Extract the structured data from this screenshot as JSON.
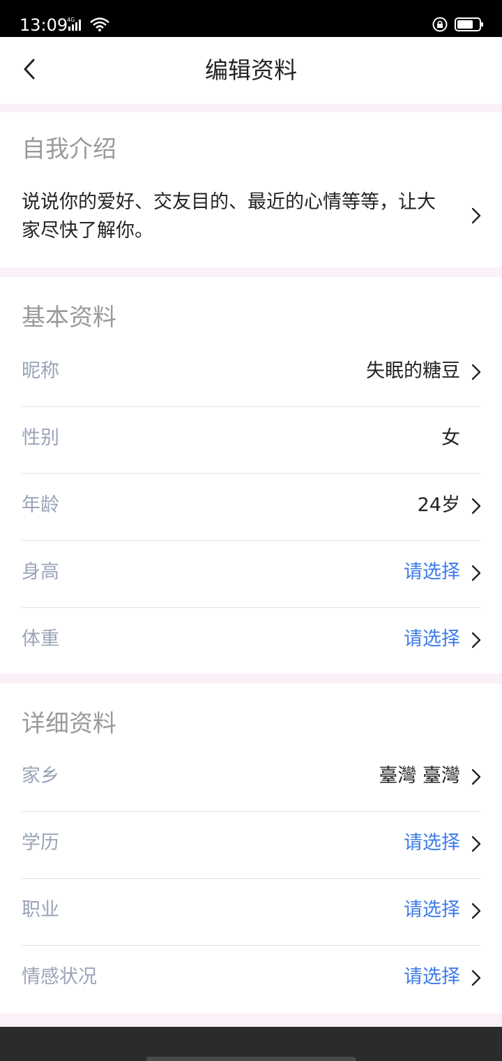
{
  "status_bar": {
    "time": "13:09",
    "network": "4G",
    "icons": [
      "signal-icon",
      "wifi-icon",
      "lock-rotation-icon",
      "battery-icon"
    ]
  },
  "header": {
    "title": "编辑资料",
    "back_icon": "chevron-left-icon"
  },
  "intro": {
    "title": "自我介绍",
    "placeholder": "说说你的爱好、交友目的、最近的心情等等，让大家尽快了解你。"
  },
  "basic": {
    "title": "基本资料",
    "rows": [
      {
        "label": "昵称",
        "value": "失眠的糖豆"
      },
      {
        "label": "性别",
        "value": "女"
      },
      {
        "label": "年龄",
        "value": "24岁"
      },
      {
        "label": "身高",
        "value": "请选择"
      },
      {
        "label": "体重",
        "value": "请选择"
      }
    ]
  },
  "detail": {
    "title": "详细资料",
    "rows": [
      {
        "label": "家乡",
        "value": "臺灣 臺灣"
      },
      {
        "label": "学历",
        "value": "请选择"
      },
      {
        "label": "职业",
        "value": "请选择"
      },
      {
        "label": "情感状况",
        "value": "请选择"
      }
    ]
  },
  "colors": {
    "section_gap": "#fbf1f8",
    "label": "#9aa3b8",
    "placeholder_value": "#3d7bea",
    "value": "#222222",
    "section_title": "#9a9a9a"
  }
}
